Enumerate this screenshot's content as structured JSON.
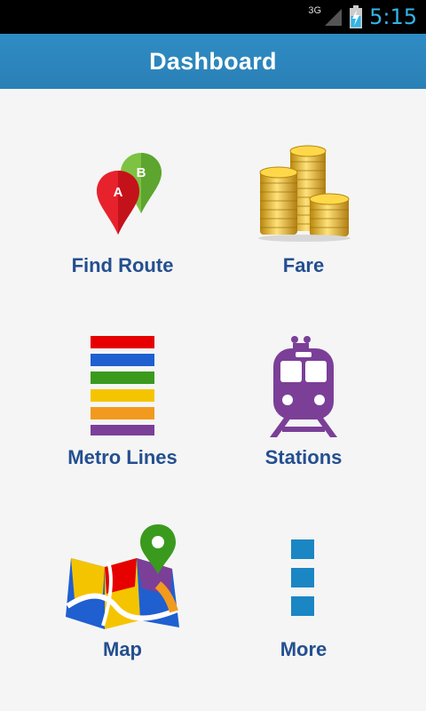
{
  "status_bar": {
    "network": "3G",
    "time": "5:15"
  },
  "header": {
    "title": "Dashboard"
  },
  "tiles": [
    {
      "label": "Find Route",
      "icon": "route-pins-icon"
    },
    {
      "label": "Fare",
      "icon": "coins-icon"
    },
    {
      "label": "Metro Lines",
      "icon": "metro-lines-icon"
    },
    {
      "label": "Stations",
      "icon": "train-icon"
    },
    {
      "label": "Map",
      "icon": "map-icon"
    },
    {
      "label": "More",
      "icon": "more-icon"
    }
  ],
  "pins": {
    "a_label": "A",
    "b_label": "B"
  },
  "colors": {
    "header": "#2a80b6",
    "label_text": "#244f8f",
    "clock": "#33b5e5",
    "line_red": "#e60000",
    "line_blue": "#1f5fd0",
    "line_green": "#3a9a1e",
    "line_yellow": "#f5c400",
    "line_orange": "#f29a1e",
    "line_purple": "#7b3f98",
    "more_blue": "#1a86c3"
  }
}
